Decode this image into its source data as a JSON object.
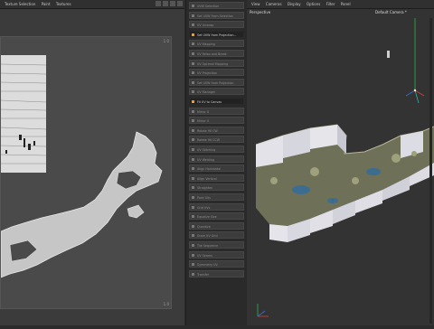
{
  "uv_editor": {
    "menu": [
      "Texture Selection",
      "Paint",
      "Textures"
    ],
    "corner_top": "1.0",
    "corner_bottom": "1.0"
  },
  "tools": [
    {
      "label": "UVW Selection",
      "kind": "normal"
    },
    {
      "label": "Set UVW From Selection",
      "kind": "normal"
    },
    {
      "label": "UV Unwrap",
      "kind": "normal"
    },
    {
      "label": "Set UVW from Projection...",
      "kind": "header"
    },
    {
      "label": "UV Mapping",
      "kind": "normal"
    },
    {
      "label": "UV Relax and Break",
      "kind": "normal"
    },
    {
      "label": "UV Optimal Mapping",
      "kind": "normal"
    },
    {
      "label": "UV Projection",
      "kind": "normal"
    },
    {
      "label": "Set UVW from Projection",
      "kind": "normal"
    },
    {
      "label": "UV Manager",
      "kind": "normal"
    },
    {
      "label": "Fit UV to Canvas",
      "kind": "header"
    },
    {
      "label": "Mirror U",
      "kind": "normal"
    },
    {
      "label": "Mirror V",
      "kind": "normal"
    },
    {
      "label": "Rotate 90 CW",
      "kind": "normal"
    },
    {
      "label": "Rotate 90 CCW",
      "kind": "normal"
    },
    {
      "label": "UV Stitching",
      "kind": "normal"
    },
    {
      "label": "UV Welding",
      "kind": "normal"
    },
    {
      "label": "Align Horizontal",
      "kind": "normal"
    },
    {
      "label": "Align Vertical",
      "kind": "normal"
    },
    {
      "label": "Straighten",
      "kind": "normal"
    },
    {
      "label": "Pack UVs",
      "kind": "normal"
    },
    {
      "label": "Grid UVs",
      "kind": "normal"
    },
    {
      "label": "Equalize Size",
      "kind": "normal"
    },
    {
      "label": "Quantize",
      "kind": "normal"
    },
    {
      "label": "Scale UV Grid",
      "kind": "normal"
    },
    {
      "label": "Tile Sequence",
      "kind": "normal"
    },
    {
      "label": "UV Seams",
      "kind": "normal"
    },
    {
      "label": "Symmetry UV",
      "kind": "normal"
    },
    {
      "label": "Transfer",
      "kind": "normal"
    }
  ],
  "viewport": {
    "menu": [
      "View",
      "Cameras",
      "Display",
      "Options",
      "Filter",
      "Panel"
    ],
    "view_name": "Perspective",
    "camera_name": "Default Camera *"
  }
}
